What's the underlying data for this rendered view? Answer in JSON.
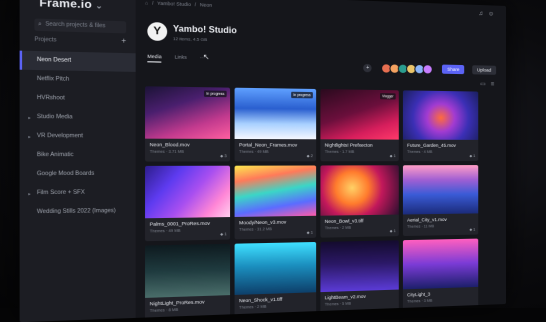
{
  "app": {
    "brand": "Frame.io",
    "brand_chevron": "⌄"
  },
  "sidebar": {
    "search_placeholder": "Search projects & files",
    "projects_header": "Projects",
    "add_label": "+",
    "items": [
      {
        "label": "Neon Desert",
        "active": true,
        "expandable": false
      },
      {
        "label": "Netflix Pitch",
        "active": false,
        "expandable": false
      },
      {
        "label": "HVRshoot",
        "active": false,
        "expandable": false
      },
      {
        "label": "Studio Media",
        "active": false,
        "expandable": true
      },
      {
        "label": "VR Development",
        "active": false,
        "expandable": true
      },
      {
        "label": "Bike Animatic",
        "active": false,
        "expandable": false
      },
      {
        "label": "Google Mood Boards",
        "active": false,
        "expandable": false
      },
      {
        "label": "Film Score + SFX",
        "active": false,
        "expandable": true
      },
      {
        "label": "Wedding Stills 2022 (Images)",
        "active": false,
        "expandable": false
      }
    ]
  },
  "header": {
    "breadcrumb": [
      "Yambo! Studio",
      "Neon"
    ],
    "icons": [
      "bell-icon",
      "user-icon"
    ],
    "logo_letter": "Y",
    "title": "Yambo! Studio",
    "subtitle": "12 items, 4.5 GB",
    "tabs": [
      {
        "label": "Media",
        "active": true
      },
      {
        "label": "Links",
        "active": false
      },
      {
        "label": "···",
        "active": false
      }
    ],
    "add_member": "+",
    "share_label": "Share",
    "upload_label": "Upload",
    "avatar_colors": [
      "#e76f51",
      "#f4a261",
      "#2a9d8f",
      "#e9c46a",
      "#8ab4f8",
      "#c77dff"
    ]
  },
  "view_icons": [
    "folder-icon",
    "list-icon"
  ],
  "assets": [
    {
      "name": "Neon_Blood.mov",
      "meta": "Themes · 3.71 MB",
      "tag": "In progress",
      "badge": "◆ 3",
      "grad": "linear-gradient(160deg,#1b1336 0%,#4a1f6e 35%,#c23a8e 70%,#ff5fa0 100%)"
    },
    {
      "name": "Portal_Neon_Frames.mov",
      "meta": "Themes · 49 MB",
      "tag": "In progress",
      "badge": "◆ 2",
      "grad": "linear-gradient(180deg,#5fa0ff 0%,#2a5fcf 40%,#a8d0ff 70%,#f5f7ff 100%)"
    },
    {
      "name": "Nightlights! Prefxecton",
      "meta": "Themes · 1.7 MB",
      "tag": "Vlogger",
      "badge": "◆ 1",
      "grad": "linear-gradient(160deg,#2a0a1e 0%,#6b0f3c 45%,#d61e5c 75%,#ff3a6a 100%)"
    },
    {
      "name": "Future_Garden_45.mov",
      "meta": "Themes · 4 MB",
      "tag": "",
      "badge": "◆ 1",
      "grad": "radial-gradient(circle at 50% 55%,#ff6b3d 0%,#a23bd1 30%,#3b2fb5 60%,#1a1f5f 100%)"
    },
    {
      "name": "Palms_0001_ProRes.mov",
      "meta": "Themes · 49 MB",
      "tag": "",
      "badge": "◆ 1",
      "grad": "linear-gradient(130deg,#2d1d8c 0%,#5e3bf0 30%,#a84ff0 55%,#ff86d6 80%,#ffd0ef 100%)"
    },
    {
      "name": "Moody/Neon_v3.mov",
      "meta": "Themes · 31.2 MB",
      "tag": "",
      "badge": "◆ 1",
      "grad": "linear-gradient(170deg,#fce94f 0%,#ff7a59 25%,#3bd6c6 50%,#5b6cff 75%,#ff5ba8 100%)"
    },
    {
      "name": "Neon_Bowl_v3.tiff",
      "meta": "Themes · 2 MB",
      "tag": "",
      "badge": "◆ 1",
      "grad": "radial-gradient(circle at 40% 45%,#ffd166 0%,#ff7b2d 30%,#c2185b 55%,#2b0f2f 100%)"
    },
    {
      "name": "Aerial_City_v1.mov",
      "meta": "Themes · 11 MB",
      "tag": "",
      "badge": "◆ 1",
      "grad": "linear-gradient(180deg,#ff9ec7 0%,#a05fd3 30%,#3a5bd6 60%,#1b2b7a 100%)"
    },
    {
      "name": "NightLight_ProRes.mov",
      "meta": "Themes · 8 MB",
      "tag": "",
      "badge": "",
      "grad": "linear-gradient(180deg,#0e1a1f 0%,#1f3b3f 50%,#4a6d6a 100%)"
    },
    {
      "name": "Neon_Shock_v1.tiff",
      "meta": "Themes · 2 MB",
      "tag": "",
      "badge": "",
      "grad": "linear-gradient(180deg,#3fe0ff 0%,#1b8fbf 45%,#0d3f6a 100%)"
    },
    {
      "name": "LightBeam_v2.mov",
      "meta": "Themes · 5 MB",
      "tag": "",
      "badge": "",
      "grad": "linear-gradient(180deg,#140b2e 0%,#2b1866 45%,#5b3bd6 100%)"
    },
    {
      "name": "CityLight_3",
      "meta": "Themes · 3 MB",
      "tag": "",
      "badge": "",
      "grad": "linear-gradient(180deg,#ff5fbf 0%,#7b3bd6 50%,#1c1f6a 100%)"
    }
  ]
}
